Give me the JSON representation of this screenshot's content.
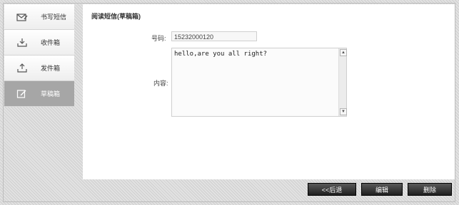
{
  "sidebar": {
    "items": [
      {
        "label": "书写短信",
        "icon": "write-message-icon",
        "active": false
      },
      {
        "label": "收件箱",
        "icon": "inbox-icon",
        "active": false
      },
      {
        "label": "发件箱",
        "icon": "outbox-icon",
        "active": false
      },
      {
        "label": "草稿箱",
        "icon": "drafts-icon",
        "active": true
      }
    ]
  },
  "main": {
    "title": "阅读短信(草稿箱)",
    "number_label": "号码:",
    "number_value": "15232000120",
    "content_label": "内容:",
    "content_value": "hello,are you all right?"
  },
  "buttons": {
    "back_label": "<<后退",
    "edit_label": "编辑",
    "delete_label": "删除"
  },
  "colors": {
    "active_nav": "#a6a6a6",
    "button_dark": "#2a2a2a"
  }
}
